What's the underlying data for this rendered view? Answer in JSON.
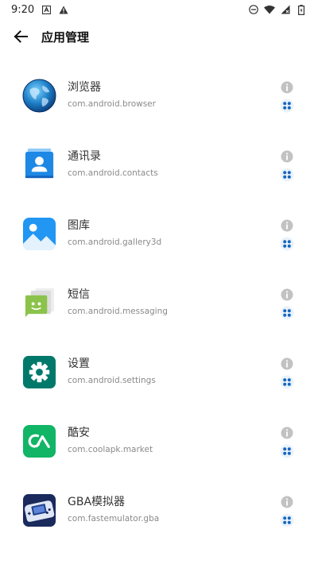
{
  "status_bar": {
    "time": "9:20",
    "icons": [
      "notification-a-icon",
      "warning-icon",
      "dnd-icon",
      "wifi-icon",
      "signal-icon",
      "battery-icon"
    ]
  },
  "header": {
    "back_icon": "arrow-back-icon",
    "title": "应用管理"
  },
  "colors": {
    "title": "#111111",
    "name": "#333333",
    "package": "#8a8a8a",
    "info_icon": "#c2c2c2",
    "module_icon": "#1565c0",
    "module_bg": "#eaf2fb"
  },
  "apps": [
    {
      "name": "浏览器",
      "package": "com.android.browser",
      "icon": "globe-icon"
    },
    {
      "name": "通讯录",
      "package": "com.android.contacts",
      "icon": "contacts-icon"
    },
    {
      "name": "图库",
      "package": "com.android.gallery3d",
      "icon": "gallery-icon"
    },
    {
      "name": "短信",
      "package": "com.android.messaging",
      "icon": "messaging-icon"
    },
    {
      "name": "设置",
      "package": "com.android.settings",
      "icon": "settings-gear-icon"
    },
    {
      "name": "酷安",
      "package": "com.coolapk.market",
      "icon": "coolapk-icon"
    },
    {
      "name": "GBA模拟器",
      "package": "com.fastemulator.gba",
      "icon": "gba-console-icon"
    }
  ]
}
